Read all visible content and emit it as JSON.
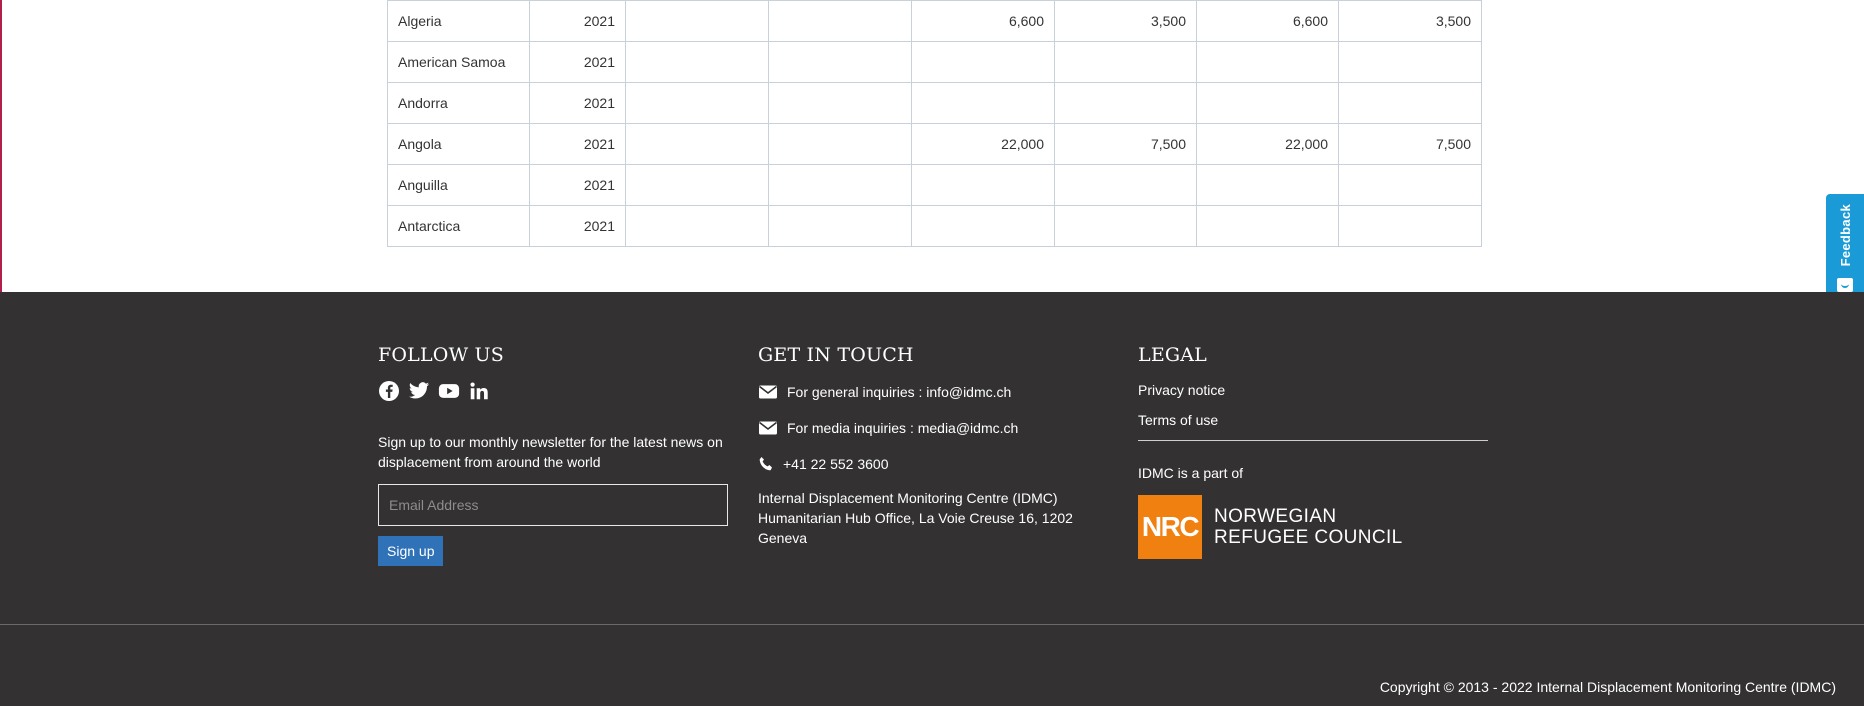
{
  "table": {
    "rows": [
      {
        "country": "Algeria",
        "year": "2021",
        "c3": "",
        "c4": "",
        "c5": "6,600",
        "c6": "3,500",
        "c7": "6,600",
        "c8": "3,500"
      },
      {
        "country": "American Samoa",
        "year": "2021",
        "c3": "",
        "c4": "",
        "c5": "",
        "c6": "",
        "c7": "",
        "c8": ""
      },
      {
        "country": "Andorra",
        "year": "2021",
        "c3": "",
        "c4": "",
        "c5": "",
        "c6": "",
        "c7": "",
        "c8": ""
      },
      {
        "country": "Angola",
        "year": "2021",
        "c3": "",
        "c4": "",
        "c5": "22,000",
        "c6": "7,500",
        "c7": "22,000",
        "c8": "7,500"
      },
      {
        "country": "Anguilla",
        "year": "2021",
        "c3": "",
        "c4": "",
        "c5": "",
        "c6": "",
        "c7": "",
        "c8": ""
      },
      {
        "country": "Antarctica",
        "year": "2021",
        "c3": "",
        "c4": "",
        "c5": "",
        "c6": "",
        "c7": "",
        "c8": ""
      }
    ]
  },
  "feedback": {
    "label": "Feedback",
    "color": "#1a9bd7"
  },
  "footer": {
    "follow": {
      "heading": "FOLLOW US",
      "icons": [
        "facebook-icon",
        "twitter-icon",
        "youtube-icon",
        "linkedin-icon"
      ],
      "newsletter_text": "Sign up to our monthly newsletter for the latest news on displacement from around the world",
      "email_placeholder": "Email Address",
      "signup_label": "Sign up"
    },
    "contact": {
      "heading": "GET IN TOUCH",
      "general": "For general inquiries : info@idmc.ch",
      "media": "For media inquiries : media@idmc.ch",
      "phone": "+41 22 552 3600",
      "address_line1": "Internal Displacement Monitoring Centre (IDMC)",
      "address_line2": "Humanitarian Hub Office, La Voie Creuse 16, 1202 Geneva"
    },
    "legal": {
      "heading": "LEGAL",
      "privacy": "Privacy notice",
      "terms": "Terms of use",
      "part_of": "IDMC is a part of",
      "nrc_logo": "NRC",
      "nrc_line1": "NORWEGIAN",
      "nrc_line2": "REFUGEE COUNCIL"
    },
    "copyright": "Copyright © 2013 - 2022 Internal Displacement Monitoring Centre (IDMC)",
    "colors": {
      "background": "#333132",
      "signup_button": "#2f72b8",
      "nrc_orange": "#f08010"
    }
  }
}
